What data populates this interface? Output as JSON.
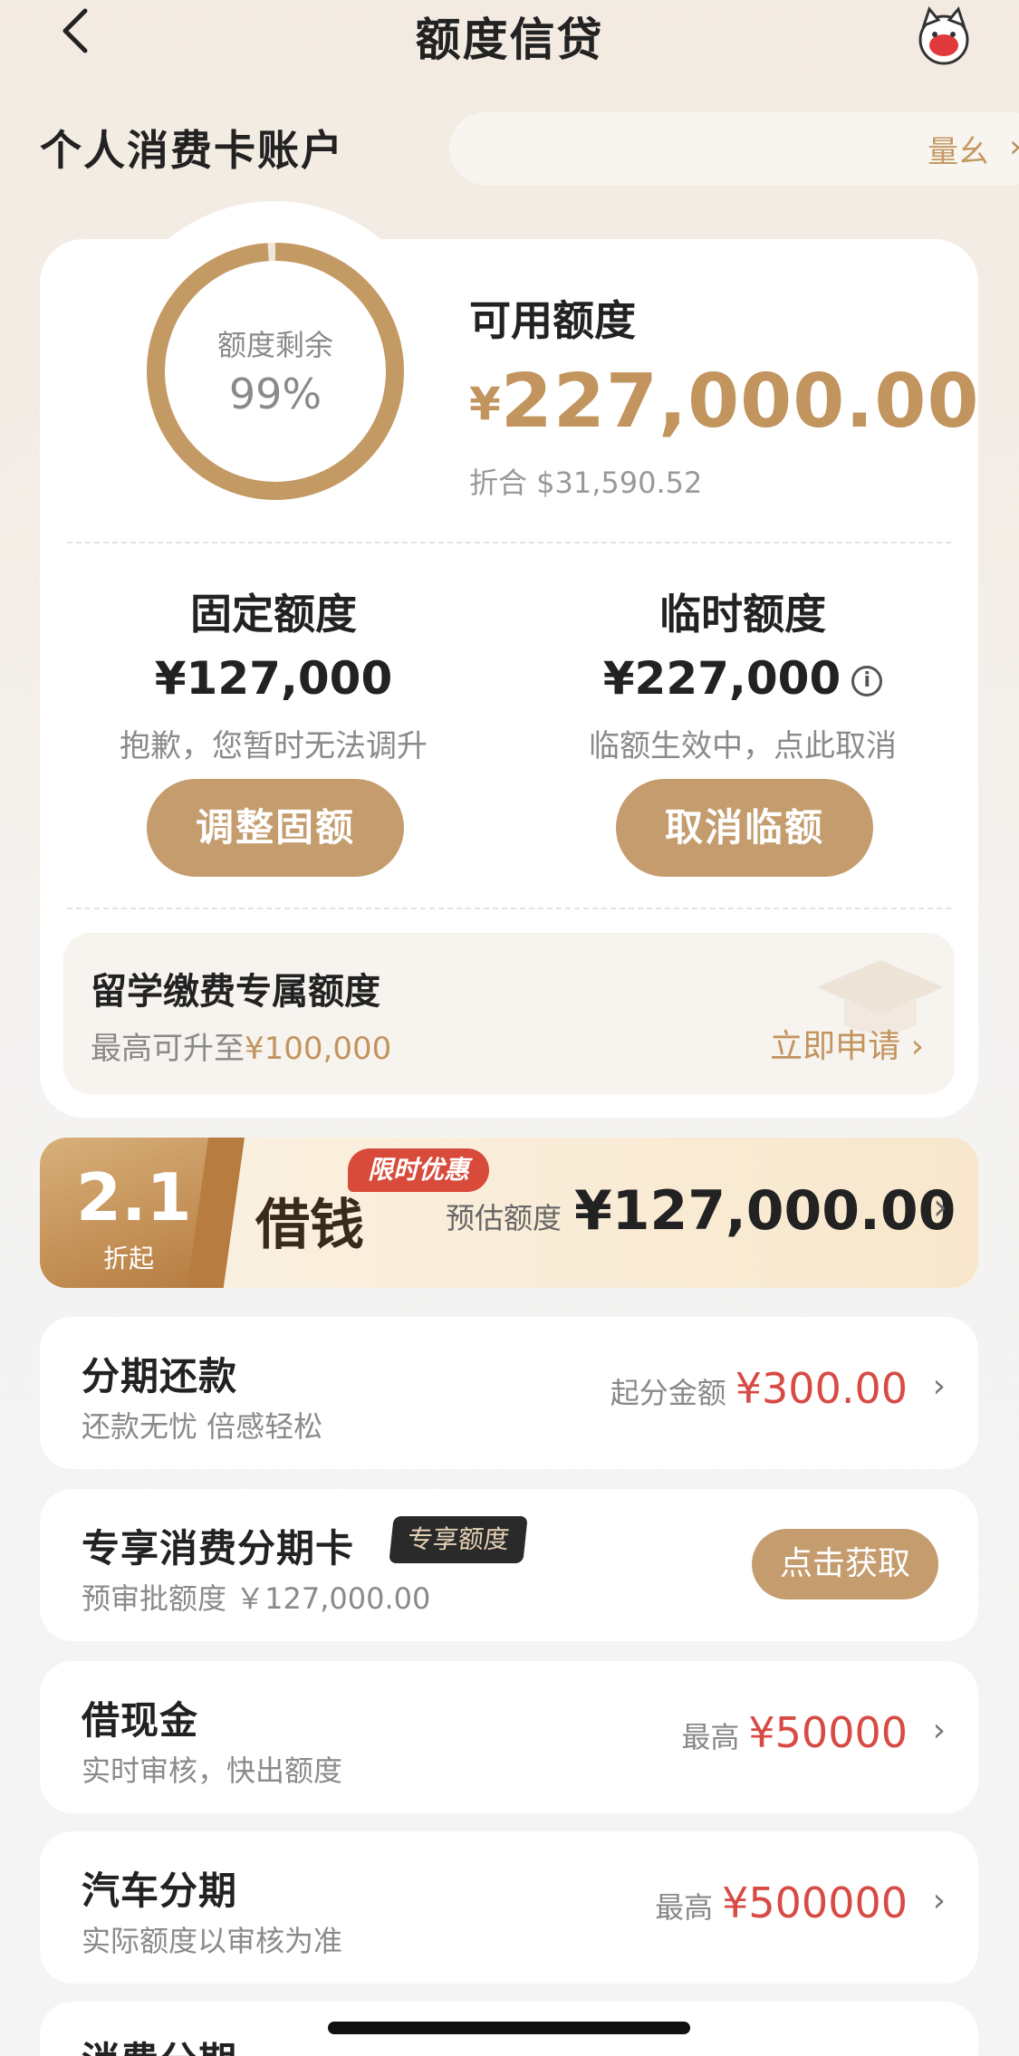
{
  "nav": {
    "title": "额度信贷"
  },
  "account": {
    "title": "个人消费卡账户",
    "pill_text": "量⼳"
  },
  "credit": {
    "ring_label": "额度剩余",
    "ring_percent": "99%",
    "ring_fraction": 0.99,
    "available_label": "可用额度",
    "available_currency": "¥",
    "available_amount": "227,000.00",
    "usd_equiv": "折合  $31,590.52",
    "fixed": {
      "title": "固定额度",
      "amount": "¥127,000",
      "note": "抱歉，您暂时无法调升",
      "button": "调整固额"
    },
    "temp": {
      "title": "临时额度",
      "amount": "¥227,000",
      "info_icon": "i",
      "note": "临额生效中，点此取消",
      "button": "取消临额"
    }
  },
  "study": {
    "title": "留学缴费专属额度",
    "sub_prefix": "最高可升至",
    "sub_amount": "¥100,000",
    "cta": "立即申请 ›"
  },
  "loan": {
    "rate": "2.1",
    "rate_sub": "折起",
    "word": "借钱",
    "badge": "限时优惠",
    "est_label": "预估额度",
    "amount": "¥127,000.00"
  },
  "items": [
    {
      "title": "分期还款",
      "sub": "还款无忧 倍感轻松",
      "right_label": "起分金额",
      "right_value": "¥300.00"
    },
    {
      "title": "专享消费分期卡",
      "tag": "专享额度",
      "sub": "预审批额度 ￥127,000.00",
      "button": "点击获取"
    },
    {
      "title": "借现金",
      "sub": "实时审核，快出额度",
      "right_label": "最高",
      "right_value": "¥50000"
    },
    {
      "title": "汽车分期",
      "sub": "实际额度以审核为准",
      "right_label": "最高",
      "right_value": "¥500000"
    },
    {
      "title": "消费分期"
    }
  ],
  "chevron": "›",
  "colors": {
    "accent": "#c49c6e",
    "price_red": "#d84a44",
    "ring": "#c49a64"
  }
}
